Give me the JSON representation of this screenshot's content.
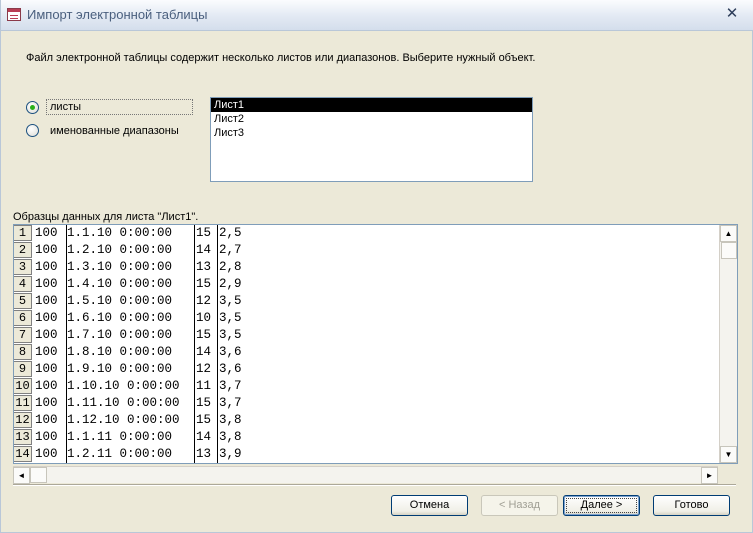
{
  "window": {
    "title": "Импорт электронной таблицы",
    "close_glyph": "✕"
  },
  "prompt": "Файл электронной таблицы содержит несколько листов или диапазонов.  Выберите нужный объект.",
  "options": {
    "sheets_label": "листы",
    "ranges_label": "именованные диапазоны",
    "selected": "sheets"
  },
  "sheet_list": [
    "Лист1",
    "Лист2",
    "Лист3"
  ],
  "selected_sheet": "Лист1",
  "sample_label": "Образцы данных для листа \"Лист1\".",
  "sample_rows": [
    {
      "n": "1",
      "c1": "100",
      "c2": "1.1.10 0:00:00",
      "c3": "15",
      "c4": "2,5"
    },
    {
      "n": "2",
      "c1": "100",
      "c2": "1.2.10 0:00:00",
      "c3": "14",
      "c4": "2,7"
    },
    {
      "n": "3",
      "c1": "100",
      "c2": "1.3.10 0:00:00",
      "c3": "13",
      "c4": "2,8"
    },
    {
      "n": "4",
      "c1": "100",
      "c2": "1.4.10 0:00:00",
      "c3": "15",
      "c4": "2,9"
    },
    {
      "n": "5",
      "c1": "100",
      "c2": "1.5.10 0:00:00",
      "c3": "12",
      "c4": "3,5"
    },
    {
      "n": "6",
      "c1": "100",
      "c2": "1.6.10 0:00:00",
      "c3": "10",
      "c4": "3,5"
    },
    {
      "n": "7",
      "c1": "100",
      "c2": "1.7.10 0:00:00",
      "c3": "15",
      "c4": "3,5"
    },
    {
      "n": "8",
      "c1": "100",
      "c2": "1.8.10 0:00:00",
      "c3": "14",
      "c4": "3,6"
    },
    {
      "n": "9",
      "c1": "100",
      "c2": "1.9.10 0:00:00",
      "c3": "12",
      "c4": "3,6"
    },
    {
      "n": "10",
      "c1": "100",
      "c2": "1.10.10 0:00:00",
      "c3": "11",
      "c4": "3,7"
    },
    {
      "n": "11",
      "c1": "100",
      "c2": "1.11.10 0:00:00",
      "c3": "15",
      "c4": "3,7"
    },
    {
      "n": "12",
      "c1": "100",
      "c2": "1.12.10 0:00:00",
      "c3": "15",
      "c4": "3,8"
    },
    {
      "n": "13",
      "c1": "100",
      "c2": "1.1.11 0:00:00",
      "c3": "14",
      "c4": "3,8"
    },
    {
      "n": "14",
      "c1": "100",
      "c2": "1.2.11 0:00:00",
      "c3": "13",
      "c4": "3,9"
    }
  ],
  "buttons": {
    "cancel": "Отмена",
    "back": "< Назад",
    "next": "Далее >",
    "finish": "Готово"
  },
  "icons": {
    "app": "spreadsheet-import-icon",
    "scroll_up": "▲",
    "scroll_down": "▼",
    "scroll_left": "◄",
    "scroll_right": "►"
  },
  "colors": {
    "radio_selected": "#29b01a",
    "selection_bg": "#000000",
    "dialog_bg": "#ece9d8"
  }
}
